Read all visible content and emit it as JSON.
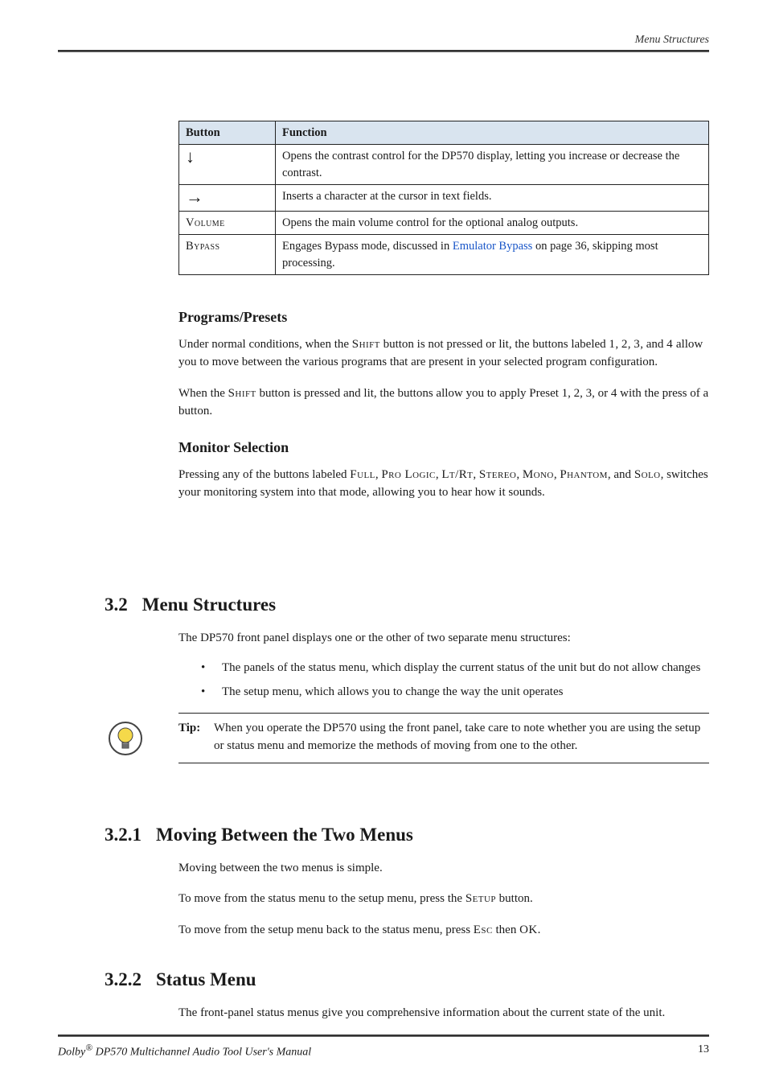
{
  "header": {
    "section_title": "Menu Structures"
  },
  "table": {
    "head": {
      "button": "Button",
      "function": "Function"
    },
    "rows": [
      {
        "button_name": "down-arrow-icon",
        "glyph": "↓",
        "func": "Opens the contrast control for the DP570 display, letting you increase or decrease the contrast."
      },
      {
        "button_name": "right-arrow-icon",
        "glyph": "→",
        "func": "Inserts a character at the cursor in text fields."
      },
      {
        "button_name": "volume-button",
        "label": "Volume",
        "func": "Opens the main volume control for the optional analog outputs."
      },
      {
        "button_name": "bypass-button",
        "label": "Bypass",
        "func_pre": "Engages Bypass mode, discussed in ",
        "func_link": "Emulator Bypass",
        "func_post": " on page 36, skipping most processing."
      }
    ]
  },
  "programs": {
    "heading": "Programs/Presets",
    "p1_a": "Under normal conditions, when the ",
    "p1_shift": "Shift",
    "p1_b": " button is not pressed or lit, the buttons labeled ",
    "p1_c": ", ",
    "p1_1": "1",
    "p1_2": "2",
    "p1_3": "3",
    "p1_4": "4",
    "p1_and": ", and ",
    "p1_d": " allow you to move between the various programs that are present in your selected program configuration.",
    "p2_a": "When the ",
    "p2_shift": "Shift",
    "p2_b": " button is pressed and lit, the buttons allow you to apply Preset 1, 2, 3, or 4 with the press of a button."
  },
  "monitor": {
    "heading": "Monitor Selection",
    "p_a": "Pressing any of the buttons labeled ",
    "b_full": "Full",
    "b_prologic": "Pro Logic",
    "b_ltrt": "Lt/Rt",
    "b_stereo": "Stereo",
    "b_mono": "Mono",
    "b_phantom": "Phantom",
    "b_solo": "Solo",
    "sep": ", ",
    "and": ", and ",
    "p_b": ", switches your monitoring system into that mode, allowing you to hear how it sounds."
  },
  "menus": {
    "num": "3.2",
    "title": "Menu Structures",
    "intro": "The DP570 front panel displays one or the other of two separate menu structures:",
    "bullet1": "The panels of the status menu, which display the current status of the unit but do not allow changes",
    "bullet2": "The setup menu, which allows you to change the way the unit operates",
    "tip_label": "Tip:",
    "tip_text": "When you operate the DP570 using the front panel, take care to note whether you are using the setup or status menu and memorize the methods of moving from one to the other."
  },
  "moving": {
    "num": "3.2.1",
    "title": "Moving Between the Two Menus",
    "p1": "Moving between the two menus is simple.",
    "p2_a": "To move from the status menu to the setup menu, press the ",
    "p2_btn": "Setup",
    "p2_b": " button.",
    "p3_a": "To move from the setup menu back to the status menu, press ",
    "p3_esc": "Esc",
    "p3_then": " then ",
    "p3_ok": "OK",
    "p3_end": "."
  },
  "status": {
    "num": "3.2.2",
    "title": "Status Menu",
    "p": "The front-panel status menus give you comprehensive information about the current state of the unit."
  },
  "footer": {
    "left_a": "Dolby",
    "reg": "®",
    "left_b": " DP570 Multichannel Audio Tool User's Manual",
    "page": "13"
  }
}
